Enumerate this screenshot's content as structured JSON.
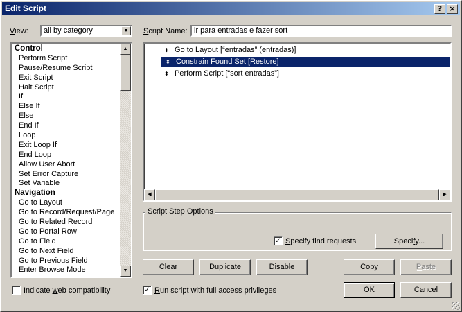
{
  "window": {
    "title": "Edit Script",
    "help_button": "?",
    "close_button": "×"
  },
  "view": {
    "label_prefix": "",
    "label_accel": "V",
    "label_rest": "iew:",
    "selected": "all by category"
  },
  "categories": [
    {
      "type": "group",
      "label": "Control"
    },
    {
      "type": "item",
      "label": "Perform Script"
    },
    {
      "type": "item",
      "label": "Pause/Resume Script"
    },
    {
      "type": "item",
      "label": "Exit Script"
    },
    {
      "type": "item",
      "label": "Halt Script"
    },
    {
      "type": "item",
      "label": "If"
    },
    {
      "type": "item",
      "label": "Else If"
    },
    {
      "type": "item",
      "label": "Else"
    },
    {
      "type": "item",
      "label": "End If"
    },
    {
      "type": "item",
      "label": "Loop"
    },
    {
      "type": "item",
      "label": "Exit Loop If"
    },
    {
      "type": "item",
      "label": "End Loop"
    },
    {
      "type": "item",
      "label": "Allow User Abort"
    },
    {
      "type": "item",
      "label": "Set Error Capture"
    },
    {
      "type": "item",
      "label": "Set Variable"
    },
    {
      "type": "group",
      "label": "Navigation"
    },
    {
      "type": "item",
      "label": "Go to Layout"
    },
    {
      "type": "item",
      "label": "Go to Record/Request/Page"
    },
    {
      "type": "item",
      "label": "Go to Related Record"
    },
    {
      "type": "item",
      "label": "Go to Portal Row"
    },
    {
      "type": "item",
      "label": "Go to Field"
    },
    {
      "type": "item",
      "label": "Go to Next Field"
    },
    {
      "type": "item",
      "label": "Go to Previous Field"
    },
    {
      "type": "item",
      "label": "Enter Browse Mode"
    }
  ],
  "script_name": {
    "label_accel": "S",
    "label_rest": "cript Name:",
    "value": "ir para entradas e fazer sort"
  },
  "steps": [
    {
      "text": "Go to Layout [“entradas” (entradas)]",
      "selected": false
    },
    {
      "text": "Constrain Found Set [Restore]",
      "selected": true
    },
    {
      "text": "Perform Script [“sort entradas”]",
      "selected": false
    }
  ],
  "step_options": {
    "title": "Script Step Options",
    "specify_find_label_accel": "S",
    "specify_find_label_rest": "pecify find requests",
    "specify_find_checked": true,
    "specify_button_before": "Speci",
    "specify_button_accel": "f",
    "specify_button_after": "y..."
  },
  "buttons": {
    "clear_accel": "C",
    "clear_rest": "lear",
    "duplicate_accel": "D",
    "duplicate_rest": "uplicate",
    "disable_before": "Disa",
    "disable_accel": "b",
    "disable_after": "le",
    "copy_before": "C",
    "copy_accel": "o",
    "copy_after": "py",
    "paste_accel": "P",
    "paste_rest": "aste",
    "ok": "OK",
    "cancel": "Cancel"
  },
  "indicate_web": {
    "before": "Indicate ",
    "accel": "w",
    "after": "eb compatibility",
    "checked": false
  },
  "full_access": {
    "before": "",
    "accel": "R",
    "after": "un script with full access privileges",
    "checked": true
  },
  "glyphs": {
    "mover": "⬍",
    "check": "✓",
    "up": "▲",
    "down": "▼",
    "left": "◀",
    "right": "▶"
  }
}
